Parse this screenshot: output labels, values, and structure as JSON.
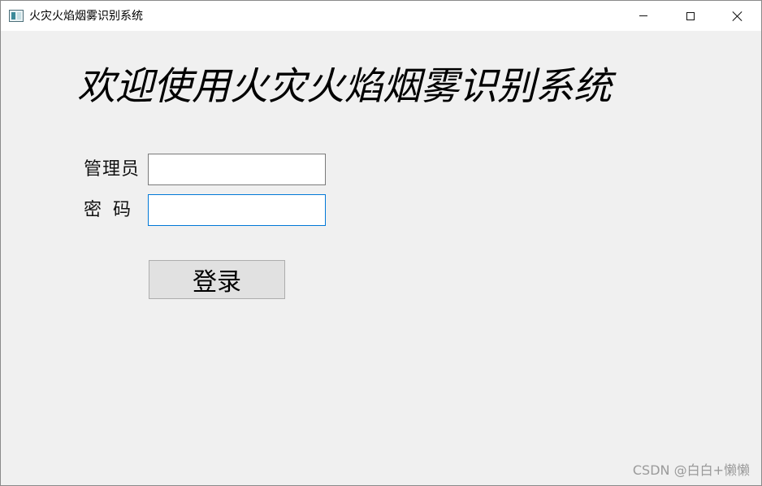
{
  "window": {
    "title": "火灾火焰烟雾识别系统"
  },
  "main": {
    "heading": "欢迎使用火灾火焰烟雾识别系统",
    "admin_label": "管理员",
    "password_label": "密  码",
    "admin_value": "",
    "password_value": "",
    "login_button": "登录"
  },
  "watermark": "CSDN @白白+懒懒",
  "colors": {
    "background": "#f0f0f0",
    "focus_border": "#0078d7",
    "button_bg": "#e1e1e1"
  },
  "icons": {
    "app": "app-window-icon",
    "minimize": "minimize-icon",
    "maximize": "maximize-icon",
    "close": "close-icon"
  }
}
